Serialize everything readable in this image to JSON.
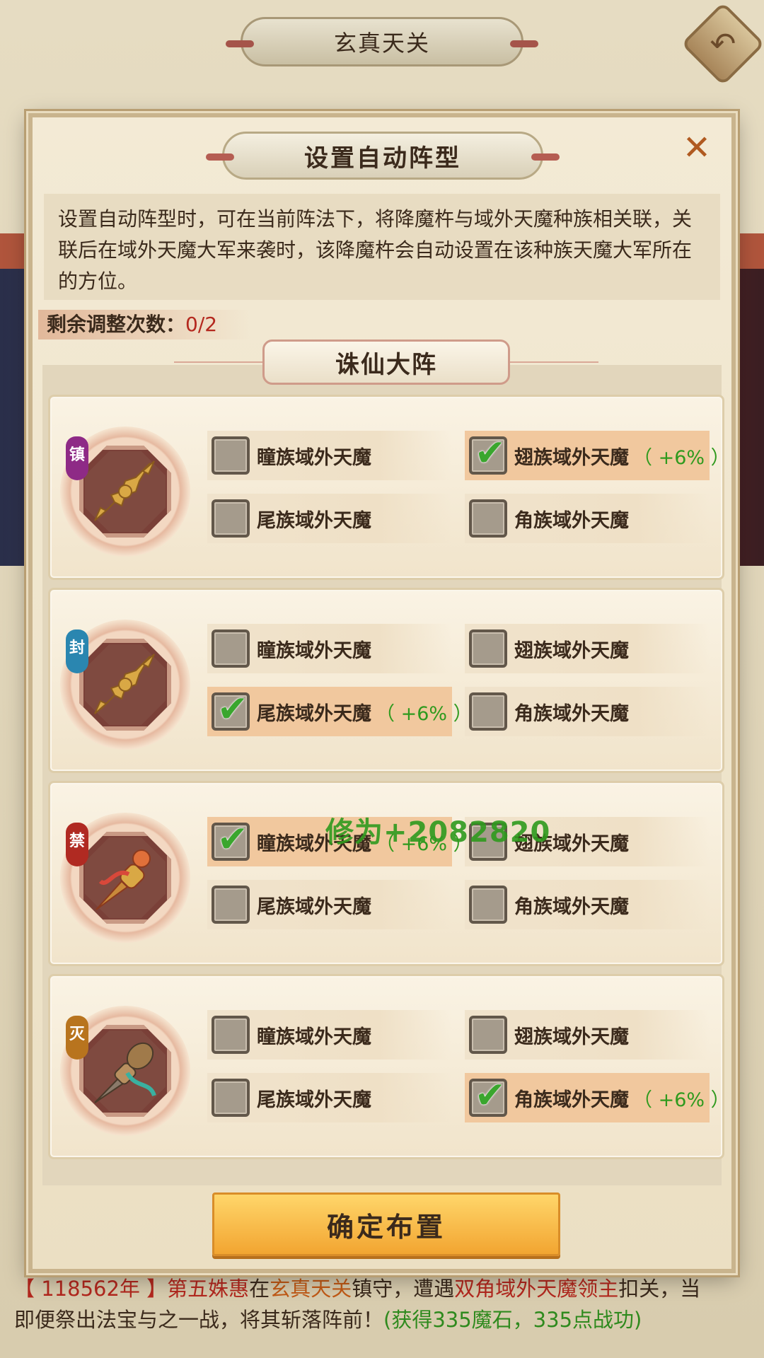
{
  "background": {
    "title": "玄真天关",
    "log_year": "【 118562年 】",
    "log_actor": "第五姝惠",
    "log_text1": "在",
    "log_place": "玄真天关",
    "log_text2": "镇守，遭遇",
    "log_enemy": "双角域外天魔领主",
    "log_text3": "扣关，当",
    "log_line2": "即便祭出法宝与之一战，将其斩落阵前！",
    "log_reward": "(获得335魔石，335点战功)"
  },
  "modal": {
    "title": "设置自动阵型",
    "description": "设置自动阵型时，可在当前阵法下，将降魔杵与域外天魔种族相关联，关联后在域外天魔大军来袭时，该降魔杵会自动设置在该种族天魔大军所在的方位。",
    "remaining_label": "剩余调整次数：",
    "remaining_value": "0/2",
    "formation_name": "诛仙大阵",
    "floating_text": "修为+2082820",
    "confirm_label": "确定布置",
    "colors": {
      "bonus": "#2f9a1e",
      "selected_bg": "#f1c89e"
    },
    "rows": [
      {
        "tag": "镇",
        "tag_color": "#8e2a86",
        "icon": "vajra-pestle-icon",
        "options": [
          {
            "label": "瞳族域外天魔",
            "checked": false,
            "bonus": ""
          },
          {
            "label": "翅族域外天魔",
            "checked": true,
            "bonus": "（ +6% ）"
          },
          {
            "label": "尾族域外天魔",
            "checked": false,
            "bonus": ""
          },
          {
            "label": "角族域外天魔",
            "checked": false,
            "bonus": ""
          }
        ]
      },
      {
        "tag": "封",
        "tag_color": "#2a86b0",
        "icon": "vajra-pestle-icon",
        "options": [
          {
            "label": "瞳族域外天魔",
            "checked": false,
            "bonus": ""
          },
          {
            "label": "翅族域外天魔",
            "checked": false,
            "bonus": ""
          },
          {
            "label": "尾族域外天魔",
            "checked": true,
            "bonus": "（ +6% ）"
          },
          {
            "label": "角族域外天魔",
            "checked": false,
            "bonus": ""
          }
        ]
      },
      {
        "tag": "禁",
        "tag_color": "#b02a22",
        "icon": "spear-pestle-icon",
        "options": [
          {
            "label": "瞳族域外天魔",
            "checked": true,
            "bonus": "（ +6% ）"
          },
          {
            "label": "翅族域外天魔",
            "checked": false,
            "bonus": ""
          },
          {
            "label": "尾族域外天魔",
            "checked": false,
            "bonus": ""
          },
          {
            "label": "角族域外天魔",
            "checked": false,
            "bonus": ""
          }
        ]
      },
      {
        "tag": "灭",
        "tag_color": "#b8741e",
        "icon": "mace-pestle-icon",
        "options": [
          {
            "label": "瞳族域外天魔",
            "checked": false,
            "bonus": ""
          },
          {
            "label": "翅族域外天魔",
            "checked": false,
            "bonus": ""
          },
          {
            "label": "尾族域外天魔",
            "checked": false,
            "bonus": ""
          },
          {
            "label": "角族域外天魔",
            "checked": true,
            "bonus": "（ +6% ）"
          }
        ]
      }
    ]
  }
}
